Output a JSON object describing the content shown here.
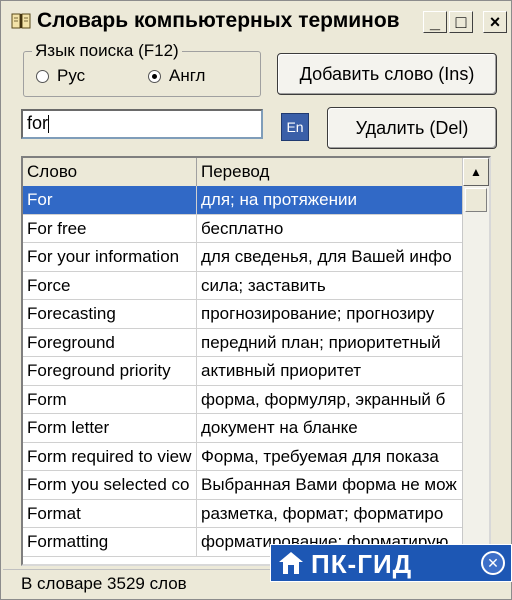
{
  "window": {
    "title": "Словарь компьютерных терминов",
    "min_symbol": "_",
    "max_symbol": "□",
    "close_symbol": "×"
  },
  "search_lang": {
    "legend": "Язык поиска (F12)",
    "options": [
      {
        "label": "Рус",
        "checked": false
      },
      {
        "label": "Англ",
        "checked": true
      }
    ]
  },
  "buttons": {
    "add": "Добавить слово (Ins)",
    "delete": "Удалить (Del)",
    "lang_toggle": "En"
  },
  "search": {
    "value": "for"
  },
  "table": {
    "columns": [
      "Слово",
      "Перевод"
    ],
    "rows": [
      {
        "word": "For",
        "translation": "для; на протяжении",
        "selected": true
      },
      {
        "word": "For free",
        "translation": "бесплатно"
      },
      {
        "word": "For your information",
        "translation": "для сведенья, для Вашей инфо"
      },
      {
        "word": "Force",
        "translation": "сила; заставить"
      },
      {
        "word": "Forecasting",
        "translation": "прогнозирование; прогнозиру"
      },
      {
        "word": "Foreground",
        "translation": "передний план; приоритетный"
      },
      {
        "word": "Foreground priority",
        "translation": "активный приоритет"
      },
      {
        "word": "Form",
        "translation": "форма, формуляр, экранный б"
      },
      {
        "word": "Form letter",
        "translation": "документ на бланке"
      },
      {
        "word": "Form required to view",
        "translation": "Форма, требуемая для показа"
      },
      {
        "word": "Form you selected co",
        "translation": "Выбранная Вами форма не мож"
      },
      {
        "word": "Format",
        "translation": "разметка, формат; форматиро"
      },
      {
        "word": "Formatting",
        "translation": "форматирование; форматирую"
      }
    ],
    "scroll_up_symbol": "▲"
  },
  "status": {
    "text": "В словаре 3529 слов"
  },
  "watermark": {
    "text": "ПК-ГИД",
    "close_symbol": "✕"
  },
  "colors": {
    "selection": "#3169c6",
    "watermark_bg": "#1d57b4",
    "window_bg": "#ece9d8"
  }
}
